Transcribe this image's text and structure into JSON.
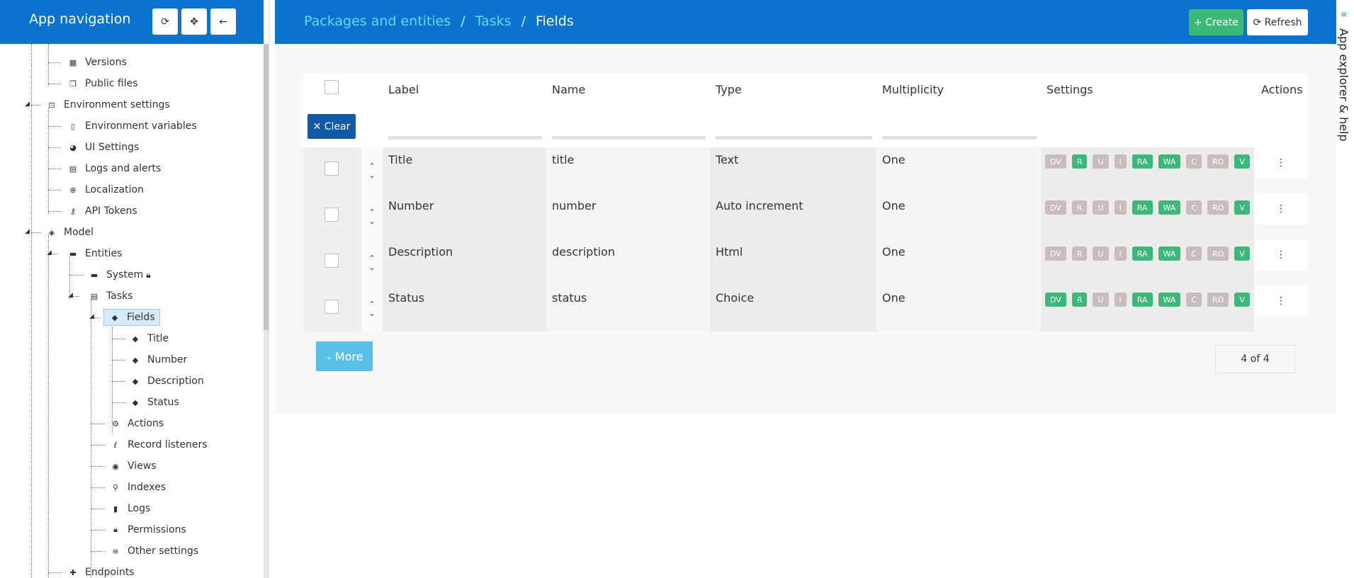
{
  "sidebar": {
    "title": "App navigation",
    "buttons": {
      "refresh": "⟳",
      "focus": "✥",
      "back": "←"
    },
    "tree": [
      {
        "label": "Versions",
        "icon": "grid-icon"
      },
      {
        "label": "Public files",
        "icon": "copy-icon"
      },
      {
        "label": "Environment settings",
        "icon": "env-icon"
      },
      {
        "label": "Environment variables",
        "icon": "clipboard-icon"
      },
      {
        "label": "UI Settings",
        "icon": "palette-icon"
      },
      {
        "label": "Logs and alerts",
        "icon": "message-icon"
      },
      {
        "label": "Localization",
        "icon": "globe-icon"
      },
      {
        "label": "API Tokens",
        "icon": "key-icon"
      },
      {
        "label": "Model",
        "icon": "layers-icon"
      },
      {
        "label": "Entities",
        "icon": "folder-icon"
      },
      {
        "label": "System",
        "icon": "folder-icon",
        "locked": true
      },
      {
        "label": "Tasks",
        "icon": "table-icon"
      },
      {
        "label": "Fields",
        "icon": "tag-icon",
        "selected": true
      },
      {
        "label": "Title",
        "icon": "tag-icon"
      },
      {
        "label": "Number",
        "icon": "tag-icon"
      },
      {
        "label": "Description",
        "icon": "tag-icon"
      },
      {
        "label": "Status",
        "icon": "tag-icon"
      },
      {
        "label": "Actions",
        "icon": "gear-icon"
      },
      {
        "label": "Record listeners",
        "icon": "ear-icon"
      },
      {
        "label": "Views",
        "icon": "eye-icon"
      },
      {
        "label": "Indexes",
        "icon": "search-icon"
      },
      {
        "label": "Logs",
        "icon": "bookmark-icon"
      },
      {
        "label": "Permissions",
        "icon": "lock-icon"
      },
      {
        "label": "Other settings",
        "icon": "list-icon"
      },
      {
        "label": "Endpoints",
        "icon": "puzzle-icon"
      }
    ]
  },
  "breadcrumb": {
    "items": [
      "Packages and entities",
      "Tasks"
    ],
    "current": "Fields",
    "separator": "/"
  },
  "toolbar": {
    "create_label": "+ Create",
    "refresh_label": "⟳ Refresh"
  },
  "table": {
    "columns": [
      "Label",
      "Name",
      "Type",
      "Multiplicity",
      "Settings",
      "Actions"
    ],
    "clear_label": "✕ Clear",
    "rows": [
      {
        "label": "Title",
        "name": "title",
        "type": "Text",
        "multiplicity": "One",
        "settings": [
          [
            "DV",
            false
          ],
          [
            "R",
            true
          ],
          [
            "U",
            false
          ],
          [
            "I",
            false
          ],
          [
            "RA",
            true
          ],
          [
            "WA",
            true
          ],
          [
            "C",
            false
          ],
          [
            "RO",
            false
          ],
          [
            "V",
            true
          ]
        ]
      },
      {
        "label": "Number",
        "name": "number",
        "type": "Auto increment",
        "multiplicity": "One",
        "settings": [
          [
            "DV",
            false
          ],
          [
            "R",
            false
          ],
          [
            "U",
            false
          ],
          [
            "I",
            false
          ],
          [
            "RA",
            true
          ],
          [
            "WA",
            true
          ],
          [
            "C",
            false
          ],
          [
            "RO",
            false
          ],
          [
            "V",
            true
          ]
        ]
      },
      {
        "label": "Description",
        "name": "description",
        "type": "Html",
        "multiplicity": "One",
        "settings": [
          [
            "DV",
            false
          ],
          [
            "R",
            false
          ],
          [
            "U",
            false
          ],
          [
            "I",
            false
          ],
          [
            "RA",
            true
          ],
          [
            "WA",
            true
          ],
          [
            "C",
            false
          ],
          [
            "RO",
            false
          ],
          [
            "V",
            true
          ]
        ]
      },
      {
        "label": "Status",
        "name": "status",
        "type": "Choice",
        "multiplicity": "One",
        "settings": [
          [
            "DV",
            true
          ],
          [
            "R",
            true
          ],
          [
            "U",
            false
          ],
          [
            "I",
            false
          ],
          [
            "RA",
            true
          ],
          [
            "WA",
            true
          ],
          [
            "C",
            false
          ],
          [
            "RO",
            false
          ],
          [
            "V",
            true
          ]
        ]
      }
    ]
  },
  "more_label": "More",
  "pager": "4 of 4",
  "help_rail": {
    "label": "App explorer & help",
    "chevron": "«"
  },
  "colors": {
    "primary": "#0a73d0",
    "success": "#3cb878",
    "muted_badge": "#c9bcbc",
    "info": "#5bc0e8",
    "dark_blue": "#125aa8"
  }
}
